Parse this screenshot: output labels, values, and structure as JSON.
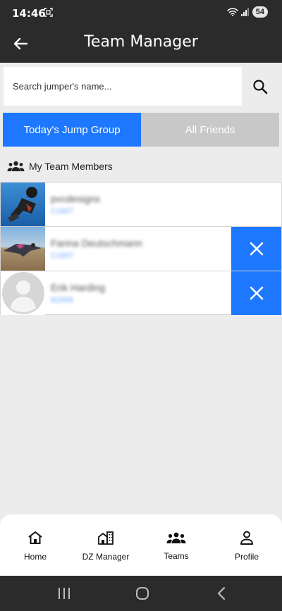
{
  "status_bar": {
    "time": "14:46",
    "battery": "54"
  },
  "header": {
    "title": "Team Manager"
  },
  "search": {
    "placeholder": "Search jumper's name..."
  },
  "tabs": [
    {
      "label": "Today's Jump Group",
      "active": true
    },
    {
      "label": "All Friends",
      "active": false
    }
  ],
  "section": {
    "title": "My Team Members"
  },
  "members": [
    {
      "name": "pvcdesigns",
      "id": "C1907",
      "removable": false
    },
    {
      "name": "Farina Deutschmann",
      "id": "C1907",
      "removable": true
    },
    {
      "name": "Erik Harding",
      "id": "B2999",
      "removable": true
    }
  ],
  "bottom_nav": [
    {
      "label": "Home",
      "icon": "home-icon"
    },
    {
      "label": "DZ Manager",
      "icon": "buildings-icon"
    },
    {
      "label": "Teams",
      "icon": "group-icon"
    },
    {
      "label": "Profile",
      "icon": "person-icon"
    }
  ],
  "colors": {
    "accent": "#1e78ff",
    "header": "#2b2b2b",
    "background": "#ececec"
  }
}
